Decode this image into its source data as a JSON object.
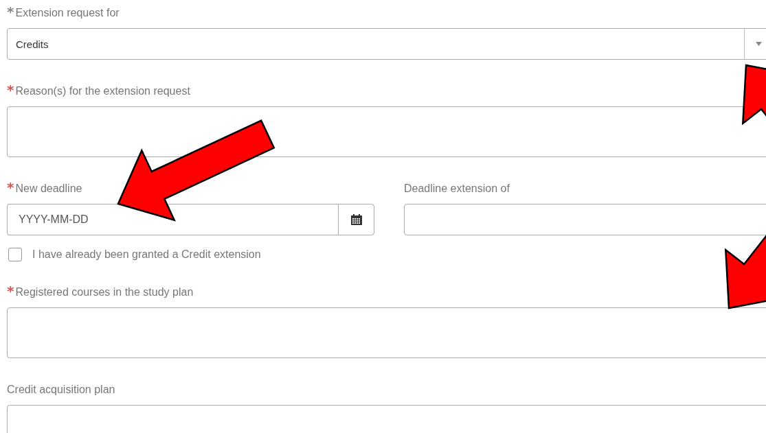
{
  "fields": [
    {
      "kind": "select",
      "label": "Extension request for",
      "marker": "*",
      "color": "#888888",
      "value": "Credits"
    },
    {
      "kind": "textarea",
      "label": "Reason(s) for the extension request",
      "marker": "*",
      "color": "#d9534f"
    },
    {
      "kind": "pair",
      "left": {
        "label": "New deadline",
        "marker": "*",
        "color": "#d9534f",
        "placeholder": "YYYY-MM-DD"
      },
      "right": {
        "label": "Deadline extension of"
      }
    },
    {
      "kind": "checkbox",
      "label": "I have already been granted a Credit extension",
      "checked": false
    },
    {
      "kind": "textarea",
      "label": "Registered courses in the study plan",
      "marker": "*",
      "color": "#d9534f"
    },
    {
      "kind": "textarea",
      "label": "Credit acquisition plan"
    }
  ]
}
